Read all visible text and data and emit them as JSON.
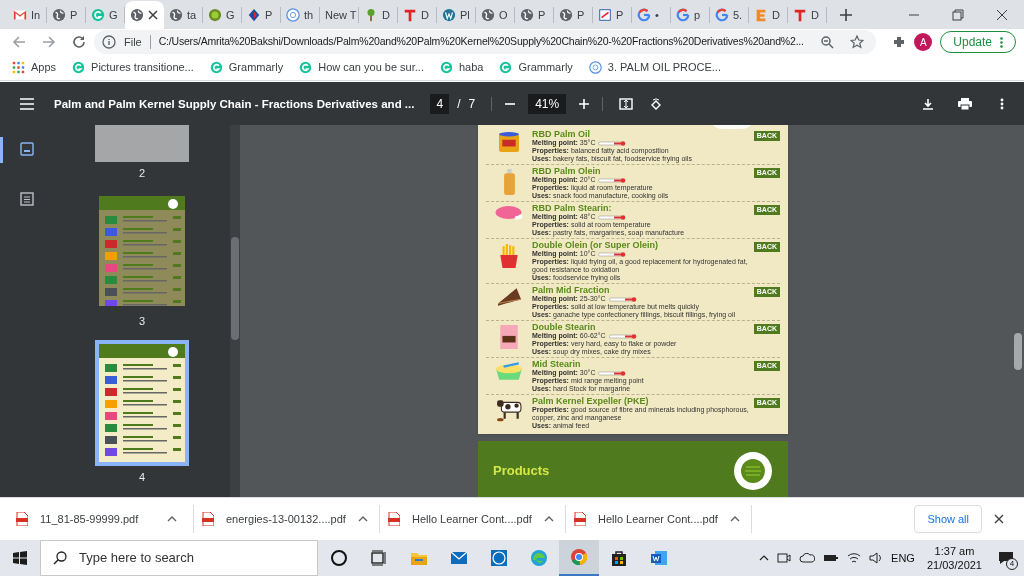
{
  "tabs": [
    {
      "label": "In",
      "kind": "gmail",
      "selected": false
    },
    {
      "label": "P",
      "kind": "globe",
      "selected": false
    },
    {
      "label": "G",
      "kind": "grammarly",
      "selected": false
    },
    {
      "kind": "globe",
      "selected": true
    },
    {
      "label": "ta",
      "kind": "globe",
      "selected": false
    },
    {
      "label": "G",
      "kind": "fruit",
      "selected": false
    },
    {
      "label": "P",
      "kind": "diamond",
      "selected": false
    },
    {
      "label": "th",
      "kind": "un",
      "selected": false
    },
    {
      "label": "New T",
      "kind": "none",
      "selected": false
    },
    {
      "label": "D",
      "kind": "plant",
      "selected": false
    },
    {
      "label": "D",
      "kind": "t",
      "selected": false
    },
    {
      "label": "Pl",
      "kind": "wordpress",
      "selected": false
    },
    {
      "label": "O",
      "kind": "globe",
      "selected": false
    },
    {
      "label": "P",
      "kind": "globe",
      "selected": false
    },
    {
      "label": "P",
      "kind": "globe",
      "selected": false
    },
    {
      "label": "P",
      "kind": "pdf",
      "selected": false
    },
    {
      "label": "•",
      "kind": "google",
      "selected": false
    },
    {
      "label": "p",
      "kind": "google",
      "selected": false
    },
    {
      "label": "5.",
      "kind": "google",
      "selected": false
    },
    {
      "label": "D",
      "kind": "e",
      "selected": false
    },
    {
      "label": "D",
      "kind": "t",
      "selected": false
    }
  ],
  "address": {
    "scheme": "File",
    "url": "C:/Users/Amrita%20Bakshi/Downloads/Palm%20and%20Palm%20Kernel%20Supply%20Chain%20-%20Fractions%20Derivatives%20and%2...",
    "profile": "A",
    "update": "Update"
  },
  "bookmarks": [
    {
      "label": "Apps",
      "kind": "apps"
    },
    {
      "label": "Pictures transitione...",
      "kind": "grammarly"
    },
    {
      "label": "Grammarly",
      "kind": "grammarly"
    },
    {
      "label": "How can you be sur...",
      "kind": "grammarly"
    },
    {
      "label": "haba",
      "kind": "grammarly"
    },
    {
      "label": "Grammarly",
      "kind": "grammarly"
    },
    {
      "label": "3. PALM OIL PROCE...",
      "kind": "un"
    }
  ],
  "pdf_toolbar": {
    "title": "Palm and Palm Kernel Supply Chain - Fractions Derivatives and ...",
    "page": "4",
    "page_separator": "/",
    "page_total": "7",
    "zoom": "41%"
  },
  "thumbnails": [
    {
      "label": "2",
      "kind": "blank",
      "selected": false
    },
    {
      "label": "3",
      "kind": "processes",
      "selected": false
    },
    {
      "label": "4",
      "kind": "products",
      "selected": true
    }
  ],
  "products": [
    {
      "name": "RBD Palm Oil",
      "kind": "can",
      "melting_point": "**Melting point:** 35°C",
      "properties": "**Properties:** balanced fatty acid composition",
      "uses": "**Uses:** bakery fats, biscuit fat, foodservice frying oils",
      "back": "BACK"
    },
    {
      "name": "RBD Palm Olein",
      "kind": "bottle",
      "melting_point": "**Melting point:** 20°C",
      "properties": "**Properties:** liquid at room temperature",
      "uses": "**Uses:** snack food manufacture, cooking oils",
      "back": "BACK"
    },
    {
      "name": "RBD Palm Stearin:",
      "kind": "soap",
      "melting_point": "**Melting point:** 48°C",
      "properties": "**Properties:** solid at room temperature",
      "uses": "**Uses:** pastry fats, margarines, soap manufacture",
      "back": "BACK"
    },
    {
      "name": "Double Olein (or Super Olein)",
      "kind": "fries",
      "melting_point": "**Melting point:** 10°C",
      "properties": "**Properties:** liquid frying oil, a good replacement for hydrogenated fat, good resistance to oxidation",
      "uses": "**Uses:** foodservice frying oils",
      "back": "BACK"
    },
    {
      "name": "Palm Mid Fraction",
      "kind": "cake",
      "melting_point": "**Melting point:** 25-30°C",
      "properties": "**Properties:** solid at low temperature but melts quickly",
      "uses": "**Uses:** ganache type confectionery fillings, biscuit fillings, frying oil",
      "back": "BACK"
    },
    {
      "name": "Double Stearin",
      "kind": "box",
      "melting_point": "**Melting point:** 60-62°C",
      "properties": "**Properties:** very hard, easy to flake or powder",
      "uses": "**Uses:** soup dry mixes, cake dry mixes",
      "back": "BACK"
    },
    {
      "name": "Mid Stearin",
      "kind": "tub",
      "melting_point": "**Melting point:** 30°C",
      "properties": "**Properties:** mid range melting point",
      "uses": "**Uses:** hard Stock for margarine",
      "back": "BACK"
    },
    {
      "name": "Palm Kernel Expeller (PKE)",
      "kind": "cow",
      "properties": "**Properties:** good source of fibre and minerals including phosphorous, copper, zinc and manganese",
      "uses": "**Uses:** animal feed",
      "back": "BACK"
    }
  ],
  "next_page": {
    "heading": "Products"
  },
  "downloads": [
    {
      "name": "11_81-85-99999.pdf"
    },
    {
      "name": "energies-13-00132....pdf"
    },
    {
      "name": "Hello Learner Cont....pdf"
    },
    {
      "name": "Hello Learner Cont....pdf"
    }
  ],
  "downloads_show_all": "Show all",
  "taskbar": {
    "search_placeholder": "Type here to search",
    "apps": [
      {
        "kind": "cortana",
        "active": false
      },
      {
        "kind": "taskview",
        "active": false
      },
      {
        "kind": "folder",
        "active": false
      },
      {
        "kind": "mail",
        "active": false
      },
      {
        "kind": "dell",
        "active": false
      },
      {
        "kind": "edge",
        "active": false
      },
      {
        "kind": "chrome",
        "active": true
      },
      {
        "kind": "store",
        "active": false
      },
      {
        "kind": "word",
        "active": false
      }
    ],
    "language": "ENG",
    "time": "1:37 am",
    "date": "21/03/2021",
    "notifications": "4"
  }
}
